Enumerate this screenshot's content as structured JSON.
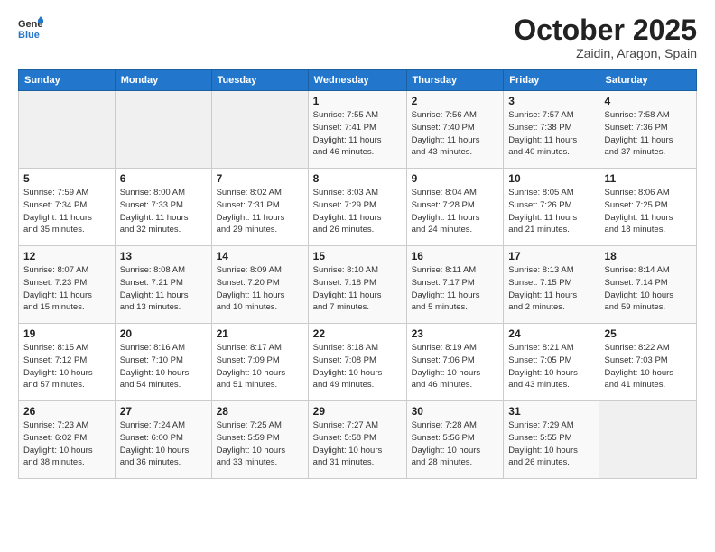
{
  "header": {
    "logo_general": "General",
    "logo_blue": "Blue",
    "month": "October 2025",
    "location": "Zaidin, Aragon, Spain"
  },
  "weekdays": [
    "Sunday",
    "Monday",
    "Tuesday",
    "Wednesday",
    "Thursday",
    "Friday",
    "Saturday"
  ],
  "weeks": [
    [
      {
        "day": "",
        "info": ""
      },
      {
        "day": "",
        "info": ""
      },
      {
        "day": "",
        "info": ""
      },
      {
        "day": "1",
        "info": "Sunrise: 7:55 AM\nSunset: 7:41 PM\nDaylight: 11 hours\nand 46 minutes."
      },
      {
        "day": "2",
        "info": "Sunrise: 7:56 AM\nSunset: 7:40 PM\nDaylight: 11 hours\nand 43 minutes."
      },
      {
        "day": "3",
        "info": "Sunrise: 7:57 AM\nSunset: 7:38 PM\nDaylight: 11 hours\nand 40 minutes."
      },
      {
        "day": "4",
        "info": "Sunrise: 7:58 AM\nSunset: 7:36 PM\nDaylight: 11 hours\nand 37 minutes."
      }
    ],
    [
      {
        "day": "5",
        "info": "Sunrise: 7:59 AM\nSunset: 7:34 PM\nDaylight: 11 hours\nand 35 minutes."
      },
      {
        "day": "6",
        "info": "Sunrise: 8:00 AM\nSunset: 7:33 PM\nDaylight: 11 hours\nand 32 minutes."
      },
      {
        "day": "7",
        "info": "Sunrise: 8:02 AM\nSunset: 7:31 PM\nDaylight: 11 hours\nand 29 minutes."
      },
      {
        "day": "8",
        "info": "Sunrise: 8:03 AM\nSunset: 7:29 PM\nDaylight: 11 hours\nand 26 minutes."
      },
      {
        "day": "9",
        "info": "Sunrise: 8:04 AM\nSunset: 7:28 PM\nDaylight: 11 hours\nand 24 minutes."
      },
      {
        "day": "10",
        "info": "Sunrise: 8:05 AM\nSunset: 7:26 PM\nDaylight: 11 hours\nand 21 minutes."
      },
      {
        "day": "11",
        "info": "Sunrise: 8:06 AM\nSunset: 7:25 PM\nDaylight: 11 hours\nand 18 minutes."
      }
    ],
    [
      {
        "day": "12",
        "info": "Sunrise: 8:07 AM\nSunset: 7:23 PM\nDaylight: 11 hours\nand 15 minutes."
      },
      {
        "day": "13",
        "info": "Sunrise: 8:08 AM\nSunset: 7:21 PM\nDaylight: 11 hours\nand 13 minutes."
      },
      {
        "day": "14",
        "info": "Sunrise: 8:09 AM\nSunset: 7:20 PM\nDaylight: 11 hours\nand 10 minutes."
      },
      {
        "day": "15",
        "info": "Sunrise: 8:10 AM\nSunset: 7:18 PM\nDaylight: 11 hours\nand 7 minutes."
      },
      {
        "day": "16",
        "info": "Sunrise: 8:11 AM\nSunset: 7:17 PM\nDaylight: 11 hours\nand 5 minutes."
      },
      {
        "day": "17",
        "info": "Sunrise: 8:13 AM\nSunset: 7:15 PM\nDaylight: 11 hours\nand 2 minutes."
      },
      {
        "day": "18",
        "info": "Sunrise: 8:14 AM\nSunset: 7:14 PM\nDaylight: 10 hours\nand 59 minutes."
      }
    ],
    [
      {
        "day": "19",
        "info": "Sunrise: 8:15 AM\nSunset: 7:12 PM\nDaylight: 10 hours\nand 57 minutes."
      },
      {
        "day": "20",
        "info": "Sunrise: 8:16 AM\nSunset: 7:10 PM\nDaylight: 10 hours\nand 54 minutes."
      },
      {
        "day": "21",
        "info": "Sunrise: 8:17 AM\nSunset: 7:09 PM\nDaylight: 10 hours\nand 51 minutes."
      },
      {
        "day": "22",
        "info": "Sunrise: 8:18 AM\nSunset: 7:08 PM\nDaylight: 10 hours\nand 49 minutes."
      },
      {
        "day": "23",
        "info": "Sunrise: 8:19 AM\nSunset: 7:06 PM\nDaylight: 10 hours\nand 46 minutes."
      },
      {
        "day": "24",
        "info": "Sunrise: 8:21 AM\nSunset: 7:05 PM\nDaylight: 10 hours\nand 43 minutes."
      },
      {
        "day": "25",
        "info": "Sunrise: 8:22 AM\nSunset: 7:03 PM\nDaylight: 10 hours\nand 41 minutes."
      }
    ],
    [
      {
        "day": "26",
        "info": "Sunrise: 7:23 AM\nSunset: 6:02 PM\nDaylight: 10 hours\nand 38 minutes."
      },
      {
        "day": "27",
        "info": "Sunrise: 7:24 AM\nSunset: 6:00 PM\nDaylight: 10 hours\nand 36 minutes."
      },
      {
        "day": "28",
        "info": "Sunrise: 7:25 AM\nSunset: 5:59 PM\nDaylight: 10 hours\nand 33 minutes."
      },
      {
        "day": "29",
        "info": "Sunrise: 7:27 AM\nSunset: 5:58 PM\nDaylight: 10 hours\nand 31 minutes."
      },
      {
        "day": "30",
        "info": "Sunrise: 7:28 AM\nSunset: 5:56 PM\nDaylight: 10 hours\nand 28 minutes."
      },
      {
        "day": "31",
        "info": "Sunrise: 7:29 AM\nSunset: 5:55 PM\nDaylight: 10 hours\nand 26 minutes."
      },
      {
        "day": "",
        "info": ""
      }
    ]
  ]
}
